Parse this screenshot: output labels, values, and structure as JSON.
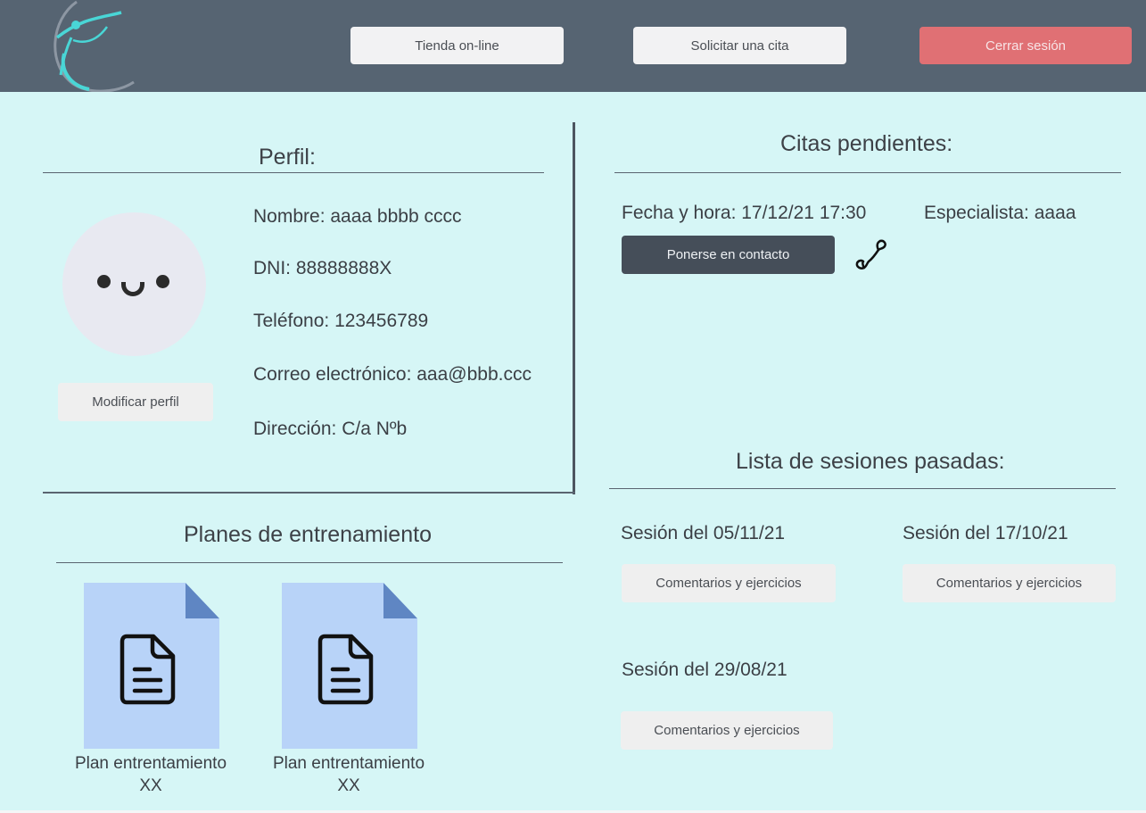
{
  "header": {
    "shop_label": "Tienda on-line",
    "appointment_label": "Solicitar una cita",
    "logout_label": "Cerrar sesión",
    "background": "#566472",
    "logout_color": "#e07074"
  },
  "profile": {
    "title": "Perfil:",
    "name": "Nombre: aaaa bbbb cccc",
    "dni": "DNI: 88888888X",
    "phone": "Teléfono: 123456789",
    "email": "Correo electrónico: aaa@bbb.ccc",
    "address": "Dirección: C/a Nºb",
    "edit_label": "Modificar perfil"
  },
  "appointments": {
    "title": "Citas pendientes:",
    "items": [
      {
        "datetime": "Fecha y hora: 17/12/21 17:30",
        "specialist": "Especialista: aaaa",
        "contact_label": "Ponerse en contacto",
        "icon": "phone-icon"
      }
    ]
  },
  "past_sessions": {
    "title": "Lista de sesiones pasadas:",
    "items": [
      {
        "label": "Sesión del 05/11/21",
        "button_label": "Comentarios y ejercicios"
      },
      {
        "label": "Sesión del 17/10/21",
        "button_label": "Comentarios y ejercicios"
      },
      {
        "label": "Sesión del 29/08/21",
        "button_label": "Comentarios y ejercicios"
      }
    ]
  },
  "plans": {
    "title": "Planes de entrenamiento",
    "items": [
      {
        "name": "Plan entrentamiento",
        "code": "XX",
        "icon": "document-icon"
      },
      {
        "name": "Plan entrentamiento",
        "code": "XX",
        "icon": "document-icon"
      }
    ]
  },
  "colors": {
    "page_background": "#d6f6f6",
    "document_fill": "#b8d3f8",
    "document_fold": "#5f86c3"
  }
}
